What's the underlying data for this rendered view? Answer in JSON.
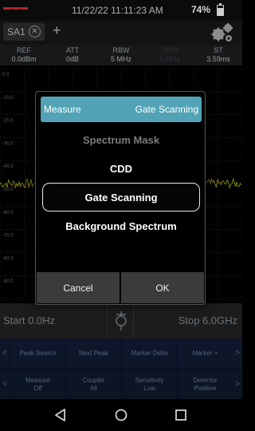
{
  "status": {
    "time": "11/22/22 11:11:23 AM",
    "battery": "74%"
  },
  "tabs": {
    "active_label": "SA1",
    "close_glyph": "✕",
    "add_glyph": "+"
  },
  "params": [
    {
      "label": "REF",
      "value": "0.0dBm",
      "dim": false
    },
    {
      "label": "ATT",
      "value": "0dB",
      "dim": false
    },
    {
      "label": "RBW",
      "value": "5 MHz",
      "dim": false
    },
    {
      "label": "VBW",
      "value": "5 MHz",
      "dim": true
    },
    {
      "label": "ST",
      "value": "3.59ms",
      "dim": false
    }
  ],
  "graph": {
    "y_ticks": [
      "0.0",
      "-10.0",
      "-20.0",
      "-30.0",
      "-40.0",
      "-50.0",
      "-60.0",
      "-70.0",
      "-80.0",
      "-90.0",
      "-100.0"
    ],
    "noise_floor_dbm": -50,
    "trace_color": "#c8c32a",
    "grid_color": "#2b3a2b"
  },
  "freqbar": {
    "start": "Start 0.0Hz",
    "stop": "Stop 6.0GHz"
  },
  "softkeys": {
    "row1": [
      "Peak Search",
      "Next Peak",
      "Marker Delta",
      "Marker +"
    ],
    "row2": [
      [
        "Measure",
        "Off"
      ],
      [
        "Coupler",
        "All"
      ],
      [
        "Sensitivity",
        "Low"
      ],
      [
        "Detector",
        "Positive"
      ]
    ],
    "left_arrow": "<",
    "right_arrow": ">"
  },
  "dialog": {
    "title": "Measure",
    "current": "Gate Scanning",
    "options": [
      {
        "label": "Spectrum Mask",
        "state": "disabled"
      },
      {
        "label": "CDD",
        "state": "normal"
      },
      {
        "label": "Gate Scanning",
        "state": "selected"
      },
      {
        "label": "Background Spectrum",
        "state": "normal"
      }
    ],
    "cancel_label": "Cancel",
    "ok_label": "OK",
    "accent_color": "#52a3b5"
  }
}
